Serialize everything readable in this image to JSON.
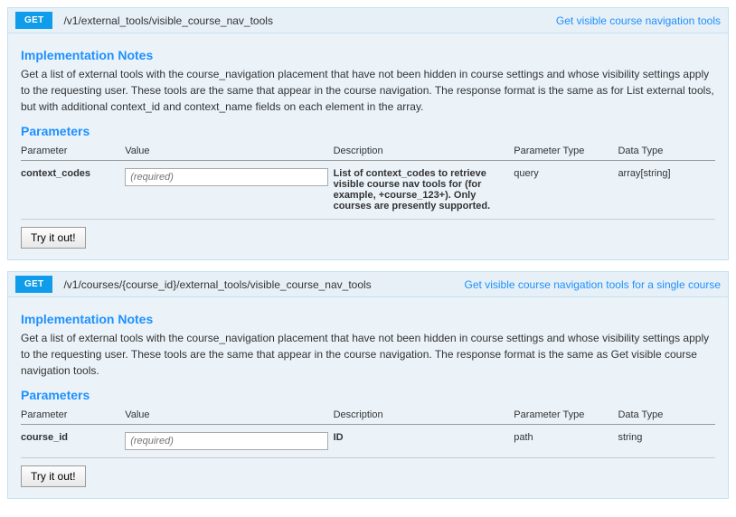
{
  "endpoints": [
    {
      "method": "GET",
      "path": "/v1/external_tools/visible_course_nav_tools",
      "link_label": "Get visible course navigation tools",
      "notes_heading": "Implementation Notes",
      "notes_text": "Get a list of external tools with the course_navigation placement that have not been hidden in course settings and whose visibility settings apply to the requesting user. These tools are the same that appear in the course navigation. The response format is the same as for List external tools, but with additional context_id and context_name fields on each element in the array.",
      "params_heading": "Parameters",
      "headers": {
        "parameter": "Parameter",
        "value": "Value",
        "description": "Description",
        "ptype": "Parameter Type",
        "dtype": "Data Type"
      },
      "rows": [
        {
          "name": "context_codes",
          "placeholder": "(required)",
          "description": "List of context_codes to retrieve visible course nav tools for (for example, +course_123+). Only courses are presently supported.",
          "ptype": "query",
          "dtype": "array[string]"
        }
      ],
      "try_label": "Try it out!"
    },
    {
      "method": "GET",
      "path": "/v1/courses/{course_id}/external_tools/visible_course_nav_tools",
      "link_label": "Get visible course navigation tools for a single course",
      "notes_heading": "Implementation Notes",
      "notes_text": "Get a list of external tools with the course_navigation placement that have not been hidden in course settings and whose visibility settings apply to the requesting user. These tools are the same that appear in the course navigation. The response format is the same as Get visible course navigation tools.",
      "params_heading": "Parameters",
      "headers": {
        "parameter": "Parameter",
        "value": "Value",
        "description": "Description",
        "ptype": "Parameter Type",
        "dtype": "Data Type"
      },
      "rows": [
        {
          "name": "course_id",
          "placeholder": "(required)",
          "description": "ID",
          "ptype": "path",
          "dtype": "string"
        }
      ],
      "try_label": "Try it out!"
    }
  ]
}
